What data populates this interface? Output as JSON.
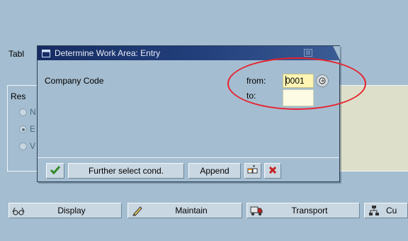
{
  "background": {
    "table_label": "Tabl",
    "group_title": "Res",
    "radio_options": [
      {
        "label": "N",
        "checked": false
      },
      {
        "label": "E",
        "checked": true
      },
      {
        "label": "V",
        "checked": false
      }
    ]
  },
  "toolbar": {
    "display_label": "Display",
    "maintain_label": "Maintain",
    "transport_label": "Transport",
    "cut_label": "Cu"
  },
  "dialog": {
    "title": "Determine Work Area: Entry",
    "company_code_label": "Company Code",
    "from_label": "from:",
    "to_label": "to:",
    "from_value": "0001",
    "to_value": "",
    "further_select_label": "Further select cond.",
    "append_label": "Append"
  },
  "colors": {
    "background": "#a4bdd0",
    "title_bar": "#1d3670",
    "input_highlight": "#fdf5b4",
    "annotation": "#e8212c",
    "confirm_check": "#2f8a2a",
    "cancel_x": "#c8201e"
  },
  "icons": {
    "display": "glasses-icon",
    "maintain": "pencil-icon",
    "transport": "truck-icon",
    "cut": "hierarchy-icon",
    "confirm": "checkmark-icon",
    "cancel": "cancel-x-icon",
    "multiple_selection": "multiple-selection-icon",
    "search_help": "search-help-icon",
    "dialog": "window-icon",
    "close": "close-icon"
  }
}
